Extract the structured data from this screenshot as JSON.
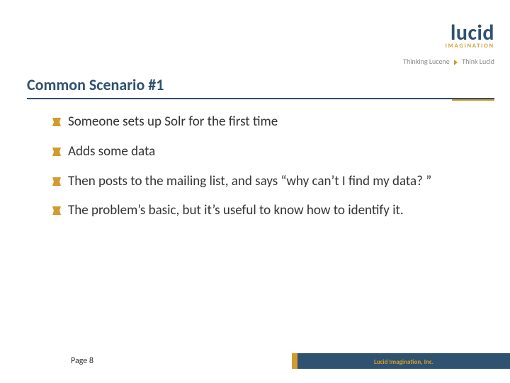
{
  "logo": {
    "word": "lucid",
    "sub": "IMAGINATION",
    "tagline_left": "Thinking Lucene",
    "tagline_right": "Think Lucid"
  },
  "title": "Common Scenario #1",
  "bullets": [
    "Someone sets up Solr for the first time",
    "Adds some data",
    "Then posts to the mailing list, and says “why can’t I find my data? ”",
    "The problem’s basic, but it’s useful to know how to identify it."
  ],
  "footer": {
    "page_label": "Page 8",
    "company": "Lucid Imagination, Inc."
  },
  "colors": {
    "blue": "#2f5270",
    "gold": "#d39a2d"
  }
}
